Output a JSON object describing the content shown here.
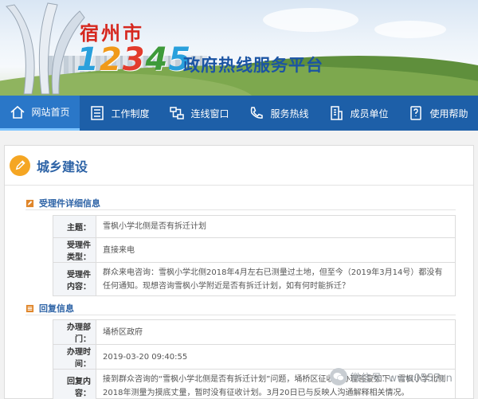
{
  "banner": {
    "city_name": "宿州市",
    "hotline_digits": [
      "1",
      "2",
      "3",
      "4",
      "5"
    ],
    "hotline_title": "政府热线服务平台",
    "digit_colors": [
      "#29a0dc",
      "#f09a1a",
      "#e23b2c",
      "#3e9a3a",
      "#29a0dc"
    ]
  },
  "nav": {
    "items": [
      {
        "label": "网站首页",
        "icon": "home-icon"
      },
      {
        "label": "工作制度",
        "icon": "document-list-icon"
      },
      {
        "label": "连线窗口",
        "icon": "network-icon"
      },
      {
        "label": "服务热线",
        "icon": "phone-icon"
      },
      {
        "label": "成员单位",
        "icon": "building-icon"
      },
      {
        "label": "使用帮助",
        "icon": "help-book-icon"
      }
    ],
    "active_index": 0
  },
  "page": {
    "title": "城乡建设",
    "title_icon": "edit-pencil-icon"
  },
  "case_section": {
    "heading": "受理件详细信息",
    "rows": [
      {
        "label": "主题：",
        "value": "雪枫小学北侧是否有拆迁计划"
      },
      {
        "label": "受理件类型：",
        "value": "直接来电"
      },
      {
        "label": "受理件内容：",
        "value": "群众来电咨询：雪枫小学北侧2018年4月左右已测量过土地，但至今（2019年3月14号）都没有任何通知。现想咨询雪枫小学附近是否有拆迁计划，如有何时能拆迁？"
      }
    ]
  },
  "reply_section": {
    "heading": "回复信息",
    "rows": [
      {
        "label": "办理部门：",
        "value": "埇桥区政府"
      },
      {
        "label": "办理时间：",
        "value": "2019-03-20 09:40:55"
      },
      {
        "label": "回复内容：",
        "value": "接到群众咨询的“雪枫小学北侧是否有拆迁计划”问题，埇桥区征收办办理答复如下：雪枫小学北侧2018年测量为摸底丈量，暂时没有征收计划。3月20日已与反映人沟通解释相关情况。"
      }
    ]
  },
  "watermark": {
    "text": "微信号: www0557cn"
  },
  "colors": {
    "nav_bg": "#1d5fa8",
    "accent": "#2d63a6",
    "city_red": "#d6281f"
  }
}
